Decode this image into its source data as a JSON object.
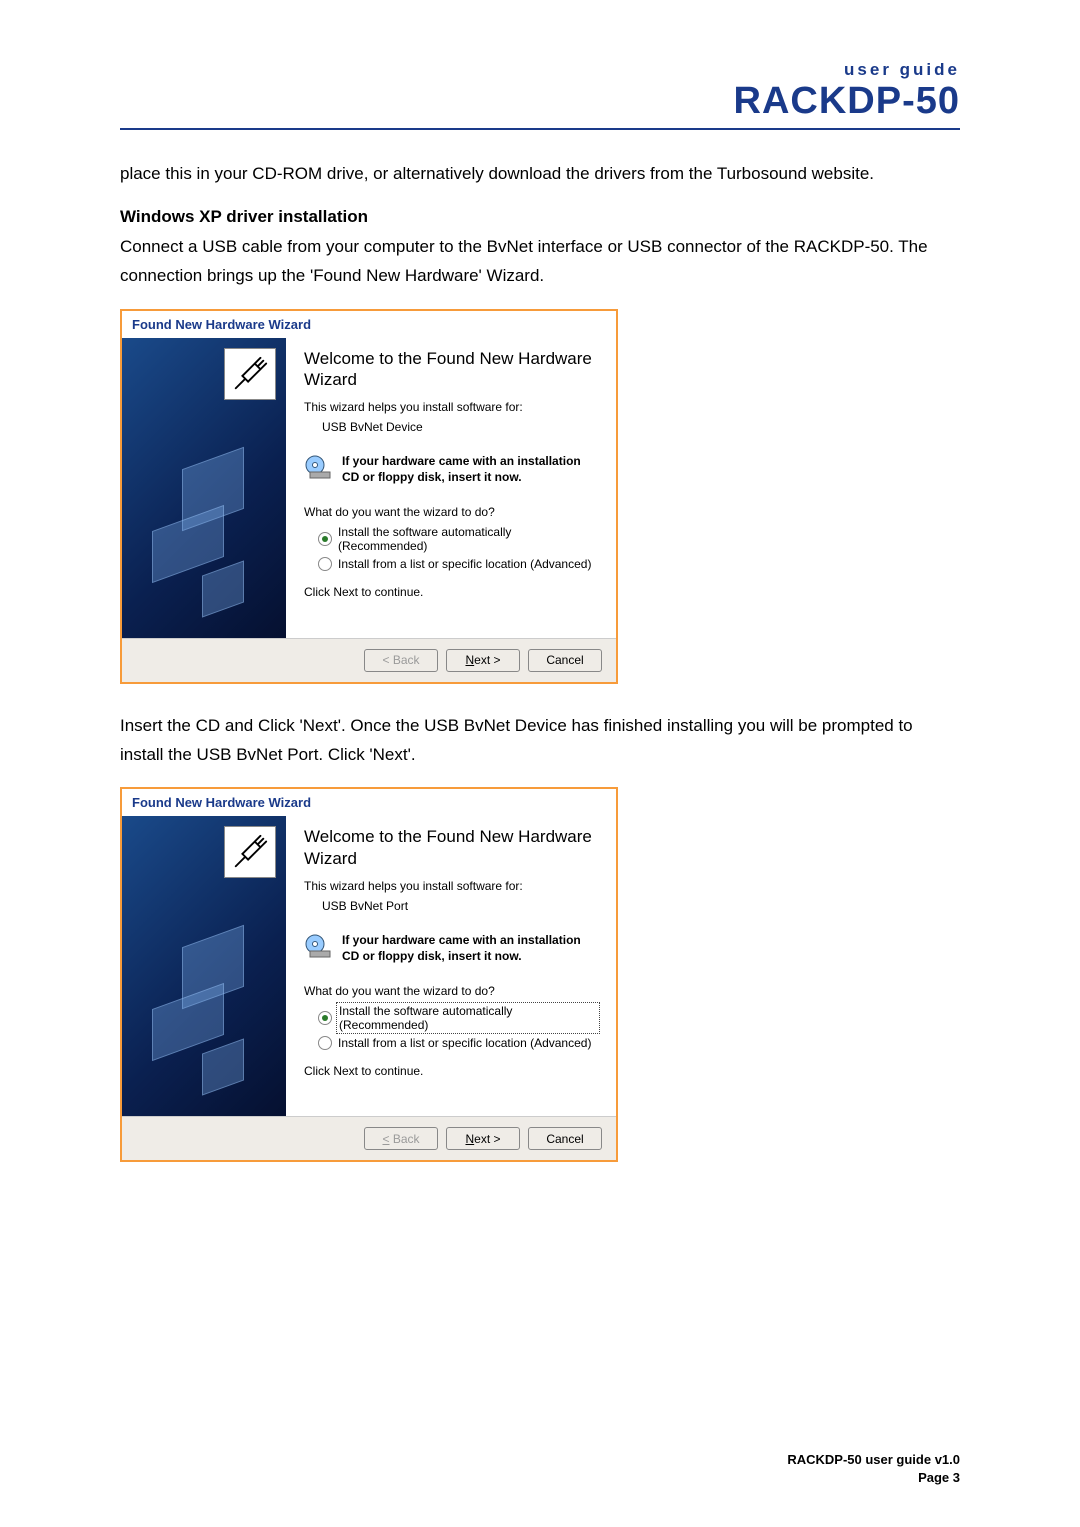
{
  "header": {
    "user_guide_label": "user guide",
    "product": "RACKDP-50"
  },
  "body": {
    "para1": "place this in your CD-ROM drive, or alternatively download the drivers from the Turbosound website.",
    "section_head": "Windows XP driver installation",
    "para2": "Connect a USB cable from your computer to the BvNet interface or USB connector of the RACKDP-50. The connection brings up the 'Found New Hardware' Wizard.",
    "para3": "Insert the CD and Click 'Next'. Once the USB BvNet Device has finished installing you will be prompted to install the USB BvNet Port. Click 'Next'."
  },
  "wizard1": {
    "window_title": "Found New Hardware Wizard",
    "title": "Welcome to the Found New Hardware Wizard",
    "helps_text": "This wizard helps you install software for:",
    "device_name": "USB BvNet Device",
    "cd_hint": "If your hardware came with an installation CD or floppy disk, insert it now.",
    "prompt": "What do you want the wizard to do?",
    "radio1": "Install the software automatically (Recommended)",
    "radio2": "Install from a list or specific location (Advanced)",
    "continue_text": "Click Next to continue.",
    "btn_back": "< Back",
    "btn_next": "Next >",
    "btn_cancel": "Cancel"
  },
  "wizard2": {
    "window_title": "Found New Hardware Wizard",
    "title": "Welcome to the Found New Hardware Wizard",
    "helps_text": "This wizard helps you install software for:",
    "device_name": "USB BvNet Port",
    "cd_hint": "If your hardware came with an installation CD or floppy disk, insert it now.",
    "prompt": "What do you want the wizard to do?",
    "radio1": "Install the software automatically (Recommended)",
    "radio2": "Install from a list or specific location (Advanced)",
    "continue_text": "Click Next to continue.",
    "btn_back": "< Back",
    "btn_next": "Next >",
    "btn_cancel": "Cancel"
  },
  "footer": {
    "line1": "RACKDP-50 user guide v1.0",
    "line2": "Page 3"
  }
}
